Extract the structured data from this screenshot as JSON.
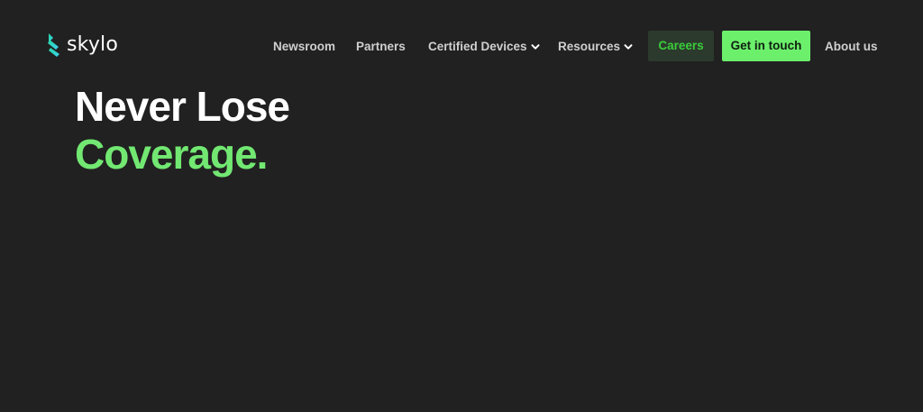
{
  "brand": {
    "name": "skylo",
    "accent": "#6cf06c",
    "logo_colors": [
      "#23d6a0",
      "#3fd1f0"
    ]
  },
  "nav": {
    "newsroom": "Newsroom",
    "partners": "Partners",
    "certified_devices": "Certified Devices",
    "resources": "Resources",
    "careers": "Careers",
    "get_in_touch": "Get in touch",
    "about_us": "About us"
  },
  "hero": {
    "line1": "Never Lose",
    "line2": "Coverage."
  }
}
